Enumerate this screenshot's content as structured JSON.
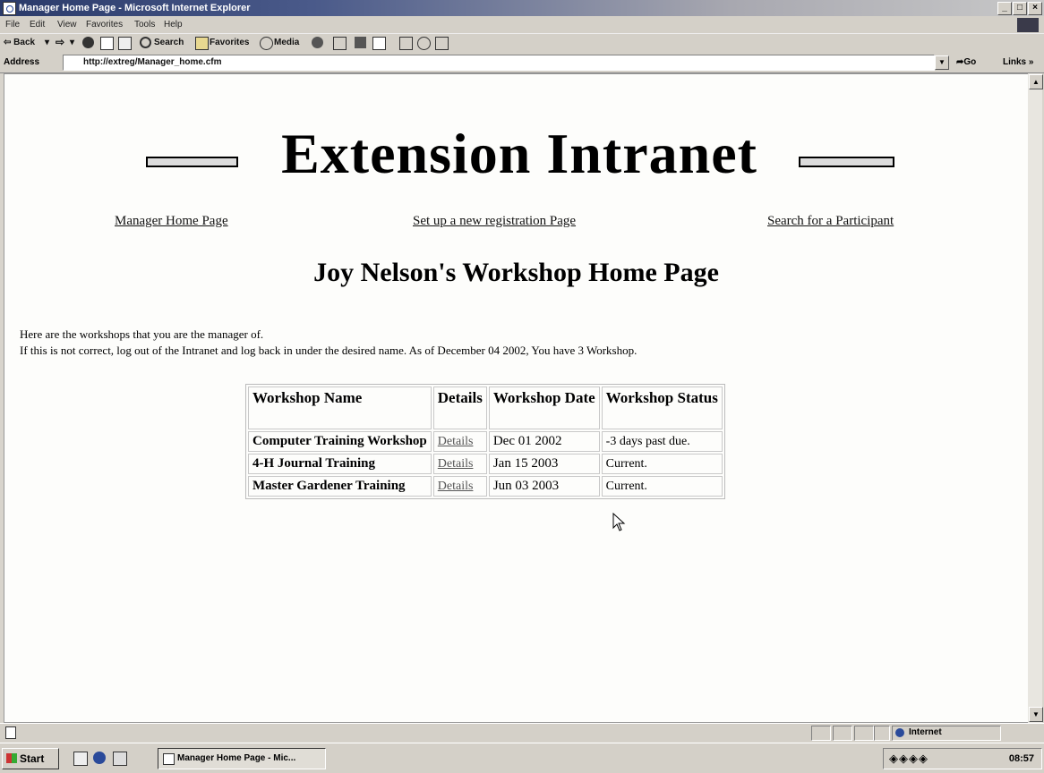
{
  "window": {
    "title": "Manager Home Page - Microsoft Internet Explorer",
    "controls": [
      "_",
      "□",
      "×"
    ]
  },
  "menu": [
    "File",
    "Edit",
    "View",
    "Favorites",
    "Tools",
    "Help"
  ],
  "toolbar": {
    "back_label": "⇦ Back",
    "back_dropdown": "▾",
    "forward": "⇨",
    "forward_dropdown": "▾",
    "search_label": "Search",
    "favorites_label": "Favorites",
    "media_label": "Media"
  },
  "address": {
    "label": "Address",
    "url": "http://extreg/Manager_home.cfm",
    "go_label": "➦Go",
    "links_label": "Links »"
  },
  "page": {
    "brand": "Extension Intranet",
    "nav": {
      "home": "Manager Home Page",
      "setup": "Set up a new registration Page",
      "search": "Search for a Participant"
    },
    "heading": "Joy Nelson's Workshop Home Page",
    "intro_line1": "Here are the workshops that you are the manager of.",
    "intro_line2": "If this is not correct, log out of the Intranet and log back in under the desired name. As of December 04 2002, You have 3 Workshop.",
    "table": {
      "headers": [
        "Workshop Name",
        "Details",
        "Workshop Date",
        "Workshop Status"
      ],
      "rows": [
        {
          "name": "Computer Training Workshop",
          "details": "Details",
          "date": "Dec 01 2002",
          "status": "-3 days past due."
        },
        {
          "name": "4-H Journal Training",
          "details": "Details",
          "date": "Jan 15 2003",
          "status": "Current."
        },
        {
          "name": "Master Gardener Training",
          "details": "Details",
          "date": "Jun 03 2003",
          "status": "Current."
        }
      ]
    }
  },
  "statusbar": {
    "zone": "Internet"
  },
  "taskbar": {
    "start": "Start",
    "task": "Manager Home Page - Mic...",
    "tray_icons": "◈◈◈◈",
    "clock": "08:57"
  }
}
